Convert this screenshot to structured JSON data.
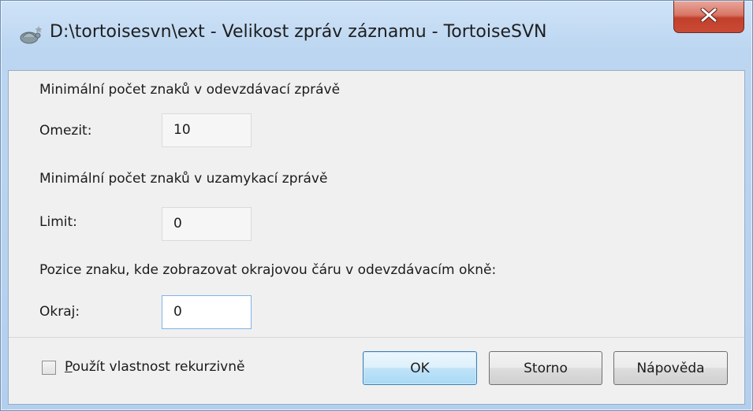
{
  "window": {
    "title": "D:\\tortoisesvn\\ext - Velikost zpráv záznamu - TortoiseSVN",
    "close_label": "x"
  },
  "commit": {
    "heading": "Minimální počet znaků v odevzdávací zprávě",
    "label": "Omezit:",
    "value": "10"
  },
  "lock": {
    "heading": "Minimální počet znaků v uzamykací zprávě",
    "label": "Limit:",
    "value": "0"
  },
  "border": {
    "heading": "Pozice znaku, kde zobrazovat okrajovou čáru v odevzdávacím okně:",
    "label": "Okraj:",
    "value": "0"
  },
  "footer": {
    "recursive_accel": "P",
    "recursive_rest": "oužít vlastnost rekurzivně",
    "recursive_checked": false,
    "ok_label": "OK",
    "cancel_label": "Storno",
    "help_label": "Nápověda"
  }
}
